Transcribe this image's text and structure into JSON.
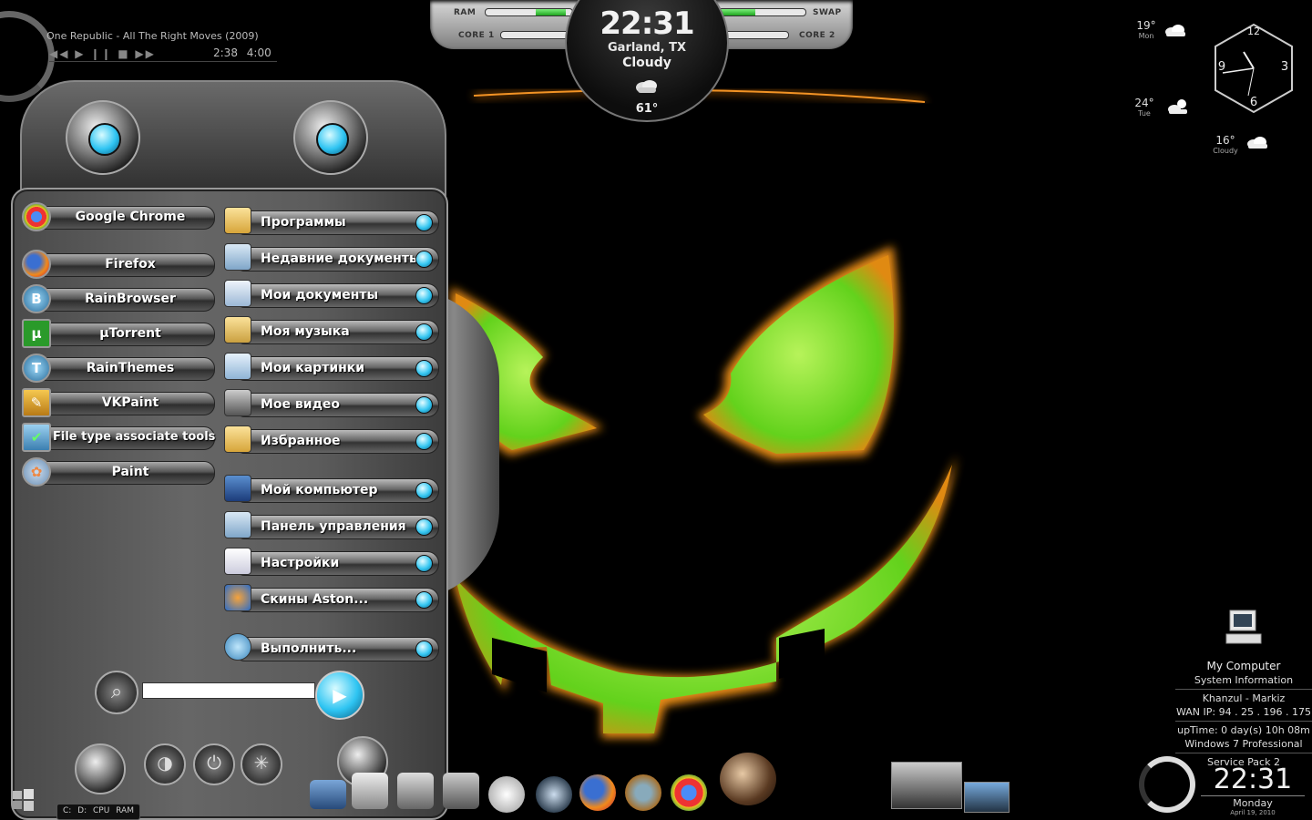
{
  "media": {
    "track": "One Republic - All The Right Moves (2009)",
    "controls": "◀◀ ▶ ❙❙ ■ ▶▶",
    "elapsed": "2:38",
    "total": "4:00"
  },
  "system_bar": {
    "ram_label": "RAM",
    "swap_label": "SWAP",
    "core1_label": "CORE 1",
    "core2_label": "CORE 2",
    "ram_usage": 0.35,
    "swap_usage": 0.42,
    "core1_usage": 0.05,
    "core2_usage": 0.05
  },
  "clock_widget": {
    "time": "22:31",
    "city": "Garland, TX",
    "condition": "Cloudy",
    "temperature": "61°",
    "icon": "cloudy-icon"
  },
  "forecast": [
    {
      "temp": "19°",
      "day": "Mon",
      "icon": "cloud-icon"
    },
    {
      "temp": "24°",
      "day": "Tue",
      "icon": "sun-cloud-icon"
    },
    {
      "temp": "16°",
      "day": "Cloudy",
      "icon": "cloud-icon"
    }
  ],
  "analog_clock": {
    "n12": "12",
    "n3": "3",
    "n6": "6",
    "n9": "9"
  },
  "menu": {
    "left_items": [
      {
        "label": "Google Chrome",
        "icon": "chrome-icon",
        "glyph": "◉"
      },
      {
        "label": "Firefox",
        "icon": "firefox-icon",
        "glyph": "◉"
      },
      {
        "label": "RainBrowser",
        "icon": "rainbrowser-icon",
        "glyph": "B"
      },
      {
        "label": "µTorrent",
        "icon": "utorrent-icon",
        "glyph": "µ"
      },
      {
        "label": "RainThemes",
        "icon": "rainthemes-icon",
        "glyph": "T"
      },
      {
        "label": "VKPaint",
        "icon": "vkpaint-icon",
        "glyph": "✎"
      },
      {
        "label": "File type associate tools",
        "icon": "file-assoc-icon",
        "glyph": "✔"
      },
      {
        "label": "Paint",
        "icon": "paint-icon",
        "glyph": "✿"
      }
    ],
    "right_items": [
      {
        "label": "Программы",
        "icon": "programs-icon"
      },
      {
        "label": "Недавние документы",
        "icon": "recent-docs-icon"
      },
      {
        "label": "Мои документы",
        "icon": "my-documents-icon"
      },
      {
        "label": "Моя музыка",
        "icon": "my-music-icon"
      },
      {
        "label": "Мои картинки",
        "icon": "my-pictures-icon"
      },
      {
        "label": "Мое видео",
        "icon": "my-video-icon"
      },
      {
        "label": "Избранное",
        "icon": "favorites-icon"
      },
      {
        "label": "Мой компьютер",
        "icon": "my-computer-icon"
      },
      {
        "label": "Панель управления",
        "icon": "control-panel-icon"
      },
      {
        "label": "Настройки",
        "icon": "settings-icon"
      },
      {
        "label": "Скины Aston...",
        "icon": "aston-skins-icon"
      },
      {
        "label": "Выполнить...",
        "icon": "run-icon"
      }
    ],
    "search_value": ""
  },
  "taskbar": {
    "drives": "C:  D:  CPU  RAM"
  },
  "desktop_icon": {
    "label": "My Computer"
  },
  "sysinfo": {
    "title": "System Information",
    "user": "Khanzul - Markiz",
    "wan": "WAN IP: 94 . 25 . 196 . 175",
    "uptime": "upTime: 0 day(s) 10h 08m",
    "os": "Windows 7 Professional",
    "sp": "Service Pack 2",
    "time": "22:31",
    "day": "Monday",
    "date": "April 19, 2010"
  },
  "colors": {
    "accent": "#2ec4f2",
    "pumpkin_glow": "#e8881a",
    "pumpkin_fill": "#7de52a"
  }
}
